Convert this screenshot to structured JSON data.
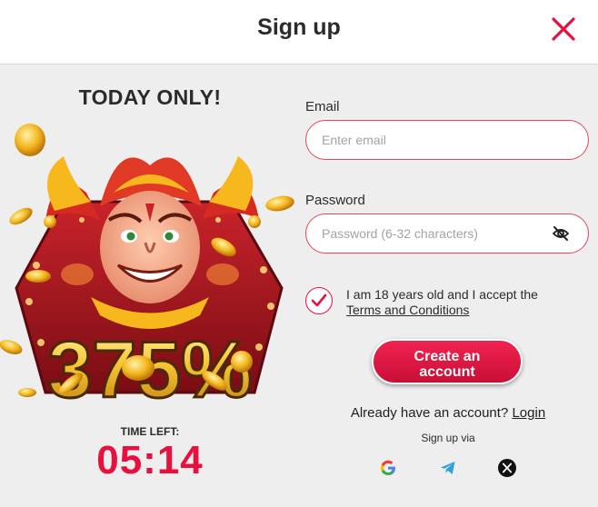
{
  "header": {
    "title": "Sign up",
    "close_icon": "close-icon"
  },
  "promo": {
    "title": "TODAY ONLY!",
    "percent": "375%",
    "time_left_label": "TIME LEFT:",
    "time_left_value": "05:14"
  },
  "form": {
    "email_label": "Email",
    "email_placeholder": "Enter email",
    "email_value": "",
    "password_label": "Password",
    "password_placeholder": "Password (6-32 characters)",
    "password_value": "",
    "age_text": "I am 18 years old and I accept the",
    "terms_link": "Terms and Conditions",
    "age_checked": true,
    "create_line1": "Create an",
    "create_line2": "account",
    "have_account": "Already have an account?",
    "login_link": "Login",
    "signup_via": "Sign up via"
  },
  "social": [
    {
      "name": "google-icon"
    },
    {
      "name": "telegram-icon"
    },
    {
      "name": "x-icon"
    }
  ],
  "colors": {
    "accent": "#e8103f",
    "input_border": "#e8445f",
    "background": "#eeeeee",
    "header_bg": "#ffffff"
  }
}
